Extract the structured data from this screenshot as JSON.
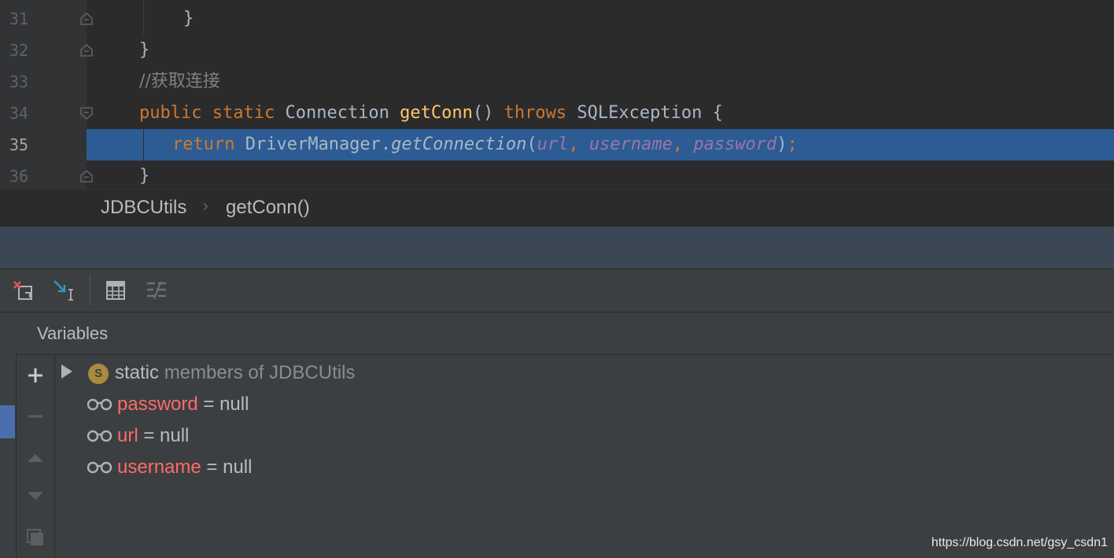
{
  "editor": {
    "lines": [
      {
        "no": "31",
        "text": "}"
      },
      {
        "no": "32",
        "text": "}"
      },
      {
        "no": "33",
        "comment": "//获取连接"
      },
      {
        "no": "34",
        "kw1": "public",
        "kw2": "static",
        "type": "Connection",
        "fn": "getConn",
        "parens": "()",
        "kw3": "throws",
        "exc": "SQLException",
        "brace": "{"
      },
      {
        "no": "35",
        "kw": "return",
        "cls": "DriverManager",
        "dot": ".",
        "method": "getConnection",
        "open": "(",
        "arg1": "url",
        "sep1": ", ",
        "arg2": "username",
        "sep2": ", ",
        "arg3": "password",
        "close": ")",
        "semi": ";"
      },
      {
        "no": "36",
        "text": "}"
      }
    ]
  },
  "breadcrumb": {
    "items": [
      "JDBCUtils",
      "getConn()"
    ],
    "separator": "›"
  },
  "toolbar": {
    "icons": [
      "remove-watch-icon",
      "step-into-icon",
      "calculator-icon",
      "settings-lines-icon"
    ]
  },
  "variables": {
    "title": "Variables",
    "static_row": {
      "badge": "S",
      "keyword": "static",
      "rest": "members of JDBCUtils"
    },
    "rows": [
      {
        "name": "password",
        "eq": "=",
        "value": "null"
      },
      {
        "name": "url",
        "eq": "=",
        "value": "null"
      },
      {
        "name": "username",
        "eq": "=",
        "value": "null"
      }
    ]
  },
  "watermark": "https://blog.csdn.net/gsy_csdn1",
  "colors": {
    "editor_bg": "#2b2b2b",
    "current_line": "#2d5c94",
    "keyword": "#cc7832",
    "function": "#ffc66d",
    "field": "#9876aa",
    "var_name": "#ff6b68",
    "panel_bg": "#3c3f41"
  }
}
